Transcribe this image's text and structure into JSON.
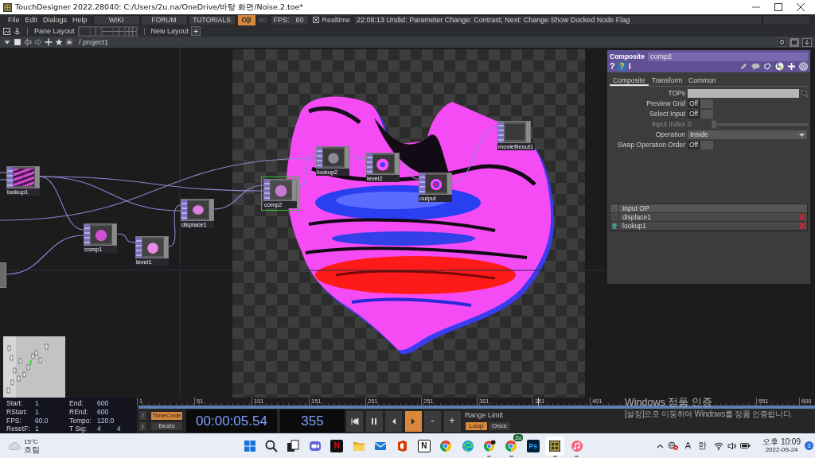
{
  "window": {
    "title": "TouchDesigner 2022.28040: C:/Users/2u.na/OneDrive/바탕 화면/Noise.2.toe*"
  },
  "menu_bar": {
    "menus": [
      "File",
      "Edit",
      "Dialogs",
      "Help"
    ],
    "links": [
      "WIKI",
      "FORUM",
      "TUTORIALS"
    ],
    "perform": {
      "label": "O|I",
      "on": true
    },
    "cook_rate": "60",
    "fps": {
      "label": "FPS:",
      "value": "60"
    },
    "realtime": {
      "label": "Realtime",
      "checked": true
    },
    "status": "22:08:13 Undid: Parameter Change: Contrast; Next: Change Show Docked Node Flag"
  },
  "pane_bar": {
    "label": "Pane Layout",
    "new_layout": "New Layout",
    "add": "+"
  },
  "path_bar": {
    "path": "/ project1",
    "count": "0"
  },
  "network": {
    "nodes": [
      {
        "name": "lookup1",
        "selected": false
      },
      {
        "name": "comp1",
        "selected": false
      },
      {
        "name": "level1",
        "selected": false
      },
      {
        "name": "displace1",
        "selected": false
      },
      {
        "name": "comp2",
        "selected": true
      },
      {
        "name": "lookup2",
        "selected": false
      },
      {
        "name": "level2",
        "selected": false
      },
      {
        "name": "output",
        "selected": false
      },
      {
        "name": "moviefileout1",
        "selected": false
      },
      {
        "selected": false
      }
    ]
  },
  "parameters": {
    "type": "Composite",
    "name": "comp2",
    "help": [
      {
        "kind": "help",
        "label": "?"
      },
      {
        "kind": "tile",
        "label": "?"
      },
      {
        "kind": "info",
        "label": "i"
      }
    ],
    "tabs": [
      {
        "label": "Composite",
        "selected": true
      },
      {
        "label": "Transform",
        "selected": false
      },
      {
        "label": "Common",
        "selected": false
      }
    ],
    "params": [
      {
        "kind": "field",
        "label": "TOPs",
        "disabled": false
      },
      {
        "kind": "toggle",
        "label": "Preview Grid",
        "value": "Off",
        "disabled": false
      },
      {
        "kind": "toggle",
        "label": "Select Input",
        "value": "Off",
        "disabled": false
      },
      {
        "kind": "slider",
        "label": "Input Index",
        "value": "0",
        "level": 0,
        "disabled": true
      },
      {
        "kind": "menu",
        "label": "Operation",
        "value": "Inside",
        "disabled": false
      },
      {
        "kind": "toggle",
        "label": "Swap Operation Order",
        "value": "Off",
        "disabled": false
      }
    ],
    "inputs": {
      "header": "Input OP",
      "rows": [
        {
          "name": "displace1",
          "arrow": false
        },
        {
          "name": "lookup1",
          "arrow": true
        }
      ]
    }
  },
  "timeline": {
    "info": [
      {
        "label": "Start:",
        "values": [
          "1"
        ]
      },
      {
        "label": "End:",
        "values": [
          "600"
        ]
      },
      {
        "label": "RStart:",
        "values": [
          "1"
        ]
      },
      {
        "label": "REnd:",
        "values": [
          "600"
        ]
      },
      {
        "label": "FPS:",
        "values": [
          "60.0"
        ]
      },
      {
        "label": "Tempo:",
        "values": [
          "120.0"
        ]
      },
      {
        "label": "ResetF:",
        "values": [
          "1"
        ]
      },
      {
        "label": "T Sig:",
        "values": [
          "4",
          "4"
        ]
      }
    ],
    "ruler": [
      "1",
      "51",
      "101",
      "151",
      "201",
      "251",
      "301",
      "351",
      "401",
      "551",
      "600"
    ],
    "playhead": {
      "level": 0.592
    },
    "tools": [
      "/",
      "I"
    ],
    "modes": [
      {
        "label": "TimeCode",
        "selected": true
      },
      {
        "label": "Beats",
        "selected": false
      }
    ],
    "timecode": "00:00:05.54",
    "frame": "355",
    "transport": [
      {
        "kind": "start",
        "on": false
      },
      {
        "kind": "pause",
        "on": false
      },
      {
        "kind": "back",
        "on": false
      },
      {
        "kind": "play",
        "on": true
      },
      {
        "kind": "text",
        "label": "-",
        "on": false
      },
      {
        "kind": "text",
        "label": "+",
        "on": false
      }
    ],
    "range": {
      "label": "Range Limit",
      "options": [
        {
          "label": "Loop",
          "selected": true
        },
        {
          "label": "Once",
          "selected": false
        }
      ]
    }
  },
  "activation_notice": {
    "title": "Windows 정품 인증",
    "message": "[설정]으로 이동하여 Windows를 정품 인증합니다."
  },
  "taskbar": {
    "weather": {
      "temperature": "15°C",
      "condition": "흐림"
    },
    "apps": [
      {
        "kind": "start",
        "running": false,
        "active": false
      },
      {
        "kind": "search",
        "running": false,
        "active": false
      },
      {
        "kind": "taskview",
        "running": false,
        "active": false
      },
      {
        "kind": "chat",
        "running": false,
        "active": false
      },
      {
        "kind": "tile",
        "label": "N",
        "running": false,
        "active": false
      },
      {
        "kind": "folder",
        "running": false,
        "active": false
      },
      {
        "kind": "mail",
        "running": false,
        "active": false
      },
      {
        "kind": "office",
        "running": false,
        "active": false
      },
      {
        "kind": "tile_light",
        "label": "N",
        "running": false,
        "active": false
      },
      {
        "kind": "chrome",
        "running": false,
        "active": false
      },
      {
        "kind": "edge",
        "running": false,
        "active": false
      },
      {
        "kind": "chrome",
        "badge": {
          "kind": "avatar"
        },
        "running": true,
        "active": false
      },
      {
        "kind": "chrome",
        "badge": {
          "kind": "text",
          "label": "2u"
        },
        "running": true,
        "active": false
      },
      {
        "kind": "tile_dark",
        "label": "Ps",
        "running": false,
        "active": false
      },
      {
        "kind": "touch",
        "running": true,
        "active": true
      },
      {
        "kind": "music",
        "running": true,
        "active": false
      }
    ],
    "tray": {
      "input": [
        "A",
        "한"
      ],
      "time": "오후 10:09",
      "date": "2022-09-24",
      "notifications": "3"
    }
  }
}
